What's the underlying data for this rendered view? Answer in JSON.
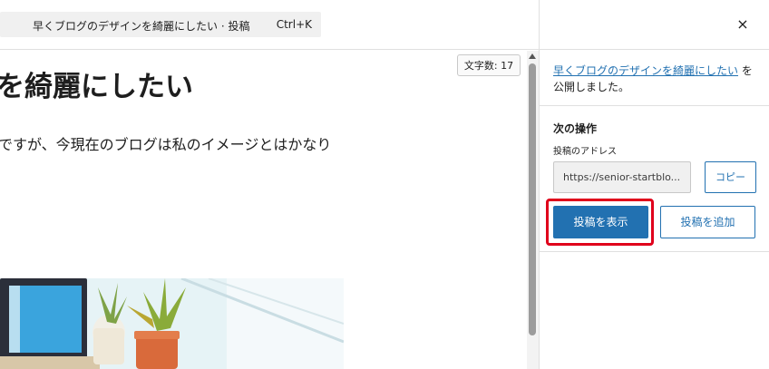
{
  "command_bar": {
    "title": "早くブログのデザインを綺麗にしたい · 投稿",
    "shortcut": "Ctrl+K"
  },
  "editor": {
    "word_count": "文字数: 17",
    "title": "を綺麗にしたい",
    "body": "ですが、今現在のブログは私のイメージとはかなり"
  },
  "panel": {
    "close_label": "×",
    "published_link": "早くブログのデザインを綺麗にしたい",
    "published_text_1": " を",
    "published_text_2": "公開しました。",
    "next_heading": "次の操作",
    "address_label": "投稿のアドレス",
    "address_value": "https://senior-startblo...",
    "copy_label": "コピー",
    "view_label": "投稿を表示",
    "add_label": "投稿を追加"
  },
  "colors": {
    "accent": "#2271b1",
    "highlight": "#e0001b"
  }
}
